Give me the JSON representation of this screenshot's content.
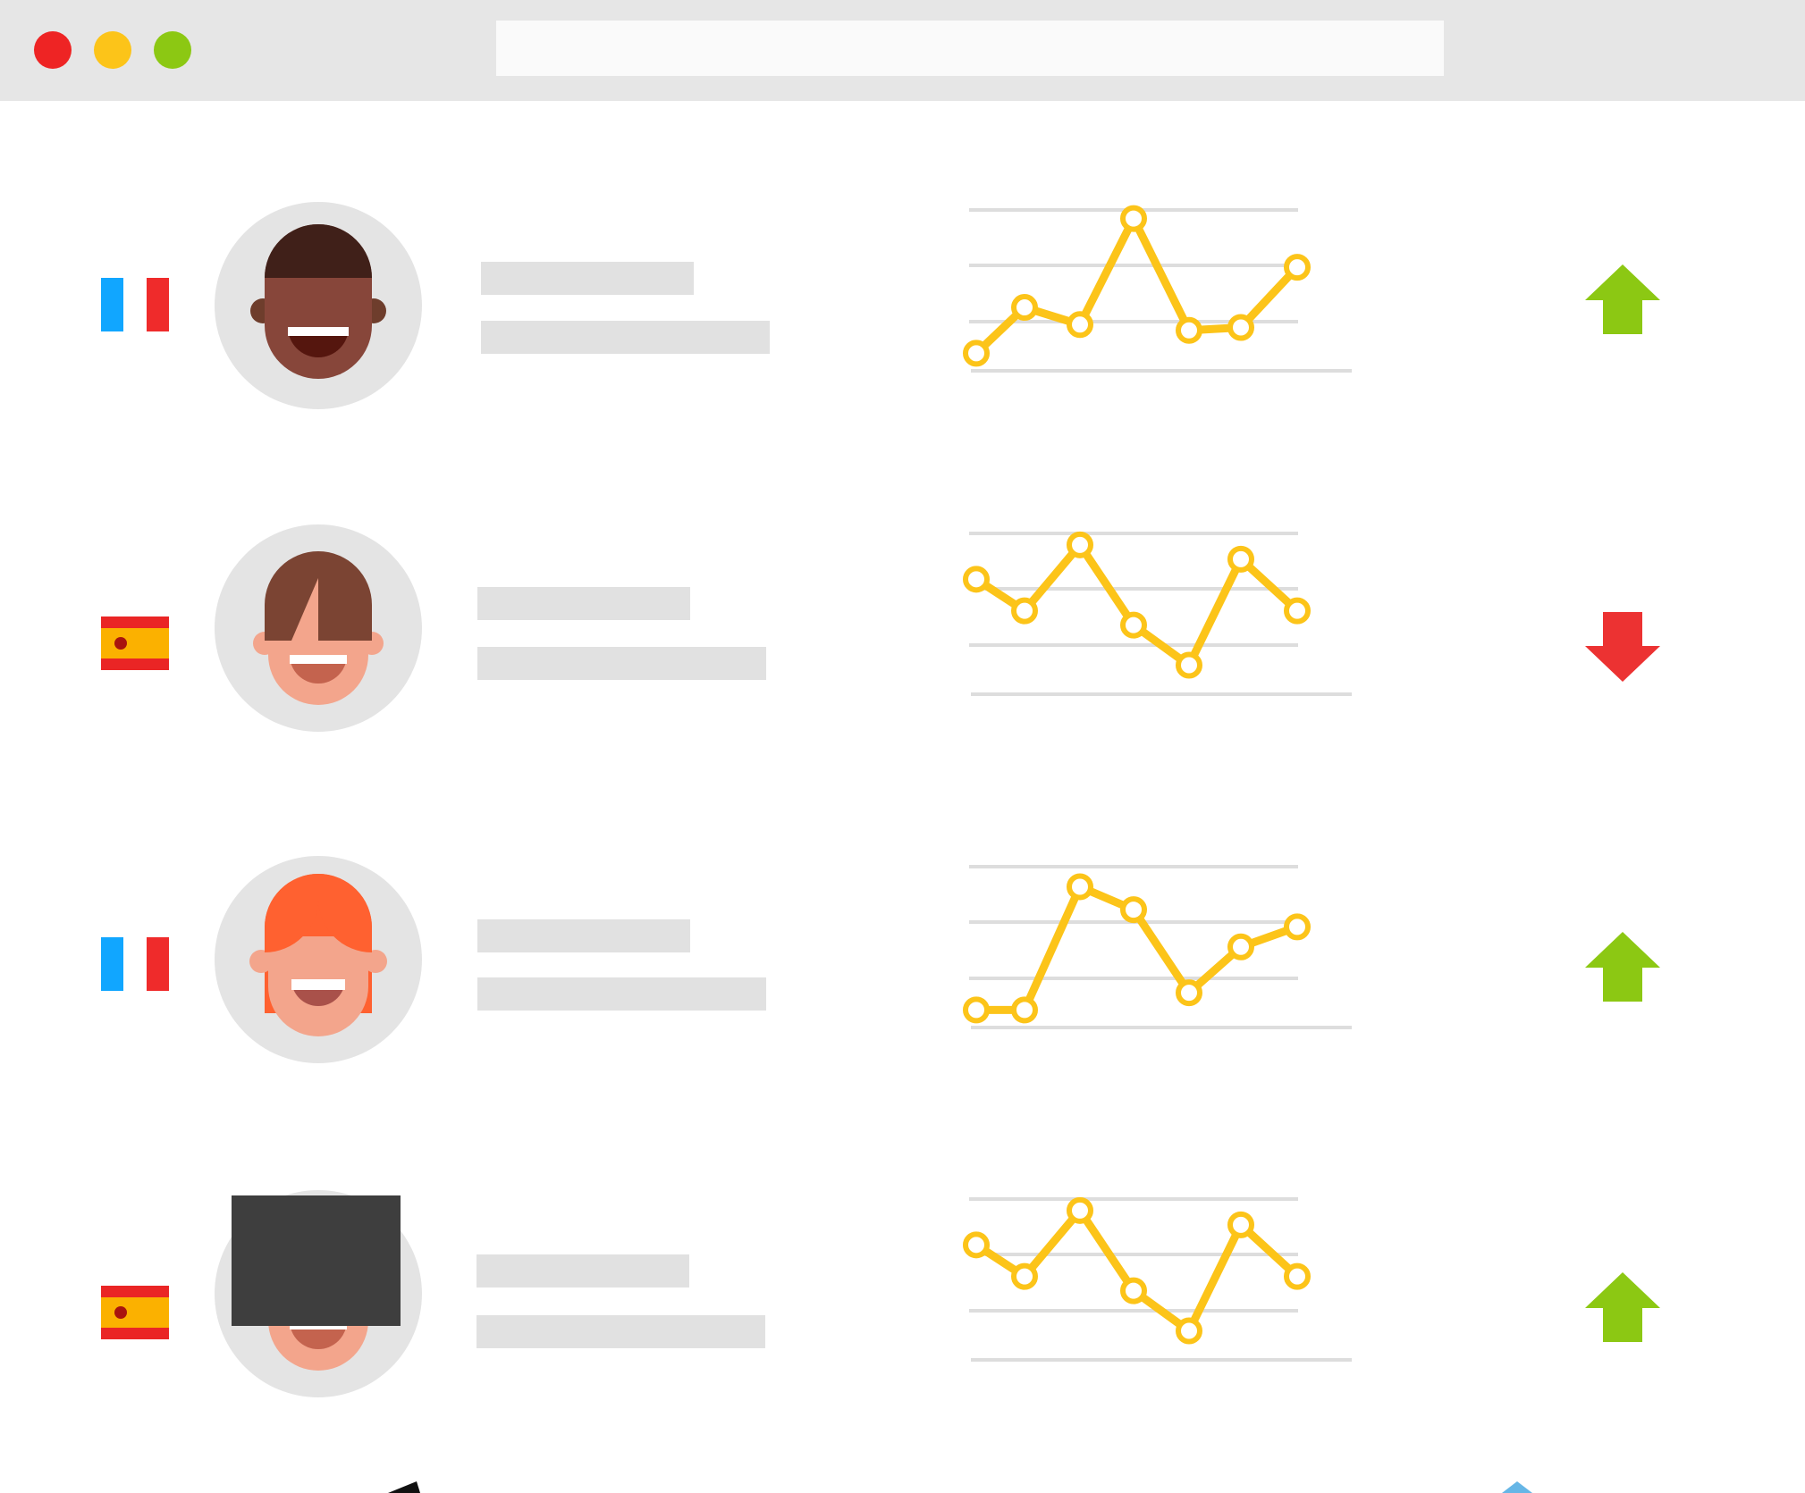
{
  "window": {
    "controls": [
      {
        "name": "close",
        "color": "#ee2424"
      },
      {
        "name": "minimize",
        "color": "#fcc419"
      },
      {
        "name": "zoom",
        "color": "#8cc813"
      }
    ],
    "address_bar": {
      "value": ""
    }
  },
  "rows": [
    {
      "flag": "france-flag",
      "avatar": "dark-skin-short-hair",
      "trend": "up",
      "trend_color": "#8cc813",
      "series": [
        1,
        2.6,
        2.0,
        5.7,
        1.8,
        1.9,
        4.0
      ]
    },
    {
      "flag": "spain-flag",
      "avatar": "light-skin-brown-hair",
      "trend": "down",
      "trend_color": "#ec3232",
      "series": [
        4.4,
        3.3,
        5.6,
        2.8,
        1.4,
        5.1,
        3.3
      ]
    },
    {
      "flag": "france-flag",
      "avatar": "light-skin-red-hair",
      "trend": "up",
      "trend_color": "#8cc813",
      "series": [
        1.0,
        1.0,
        5.3,
        4.5,
        1.6,
        3.2,
        3.9
      ]
    },
    {
      "flag": "spain-flag",
      "avatar": "light-skin-redacted",
      "trend": "up",
      "trend_color": "#8cc813",
      "series": [
        4.4,
        3.3,
        5.6,
        2.8,
        1.4,
        5.1,
        3.3
      ]
    }
  ],
  "colors": {
    "spark_line": "#fcc419",
    "grid": "#dddddd",
    "placeholder": "#e1e1e1",
    "avatar_bg": "#e4e4e4"
  }
}
